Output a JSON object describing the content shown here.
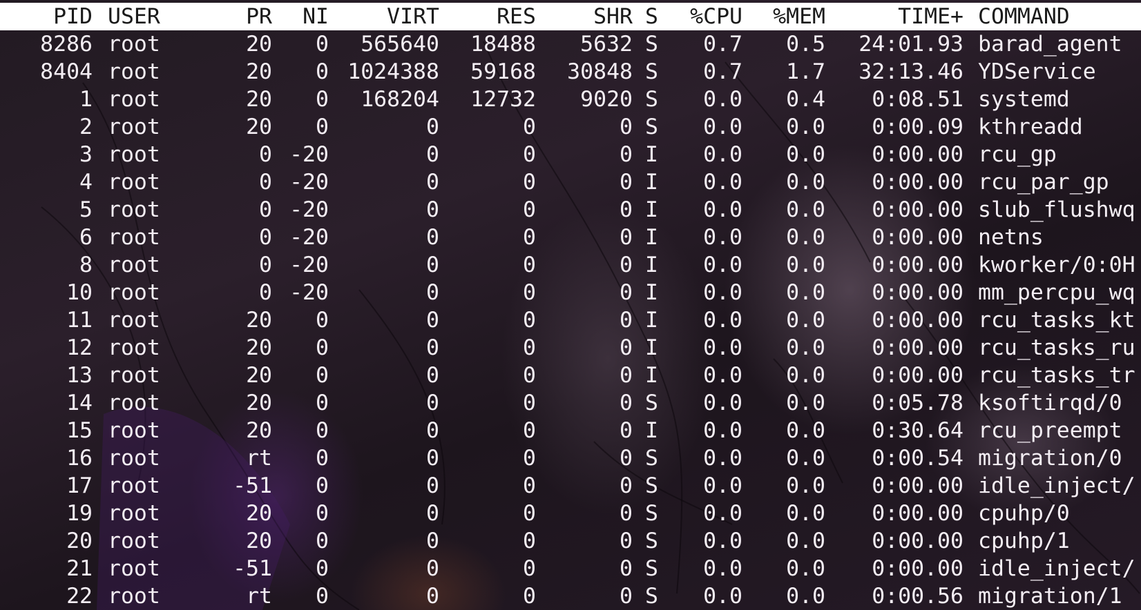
{
  "columns": [
    "PID",
    "USER",
    "PR",
    "NI",
    "VIRT",
    "RES",
    "SHR",
    "S",
    "%CPU",
    "%MEM",
    "TIME+",
    "COMMAND"
  ],
  "processes": [
    [
      "8286",
      "root",
      "20",
      "0",
      "565640",
      "18488",
      "5632",
      "S",
      "0.7",
      "0.5",
      "24:01.93",
      "barad_agent"
    ],
    [
      "8404",
      "root",
      "20",
      "0",
      "1024388",
      "59168",
      "30848",
      "S",
      "0.7",
      "1.7",
      "32:13.46",
      "YDService"
    ],
    [
      "1",
      "root",
      "20",
      "0",
      "168204",
      "12732",
      "9020",
      "S",
      "0.0",
      "0.4",
      "0:08.51",
      "systemd"
    ],
    [
      "2",
      "root",
      "20",
      "0",
      "0",
      "0",
      "0",
      "S",
      "0.0",
      "0.0",
      "0:00.09",
      "kthreadd"
    ],
    [
      "3",
      "root",
      "0",
      "-20",
      "0",
      "0",
      "0",
      "I",
      "0.0",
      "0.0",
      "0:00.00",
      "rcu_gp"
    ],
    [
      "4",
      "root",
      "0",
      "-20",
      "0",
      "0",
      "0",
      "I",
      "0.0",
      "0.0",
      "0:00.00",
      "rcu_par_gp"
    ],
    [
      "5",
      "root",
      "0",
      "-20",
      "0",
      "0",
      "0",
      "I",
      "0.0",
      "0.0",
      "0:00.00",
      "slub_flushwq"
    ],
    [
      "6",
      "root",
      "0",
      "-20",
      "0",
      "0",
      "0",
      "I",
      "0.0",
      "0.0",
      "0:00.00",
      "netns"
    ],
    [
      "8",
      "root",
      "0",
      "-20",
      "0",
      "0",
      "0",
      "I",
      "0.0",
      "0.0",
      "0:00.00",
      "kworker/0:0H"
    ],
    [
      "10",
      "root",
      "0",
      "-20",
      "0",
      "0",
      "0",
      "I",
      "0.0",
      "0.0",
      "0:00.00",
      "mm_percpu_wq"
    ],
    [
      "11",
      "root",
      "20",
      "0",
      "0",
      "0",
      "0",
      "I",
      "0.0",
      "0.0",
      "0:00.00",
      "rcu_tasks_kt"
    ],
    [
      "12",
      "root",
      "20",
      "0",
      "0",
      "0",
      "0",
      "I",
      "0.0",
      "0.0",
      "0:00.00",
      "rcu_tasks_ru"
    ],
    [
      "13",
      "root",
      "20",
      "0",
      "0",
      "0",
      "0",
      "I",
      "0.0",
      "0.0",
      "0:00.00",
      "rcu_tasks_tr"
    ],
    [
      "14",
      "root",
      "20",
      "0",
      "0",
      "0",
      "0",
      "S",
      "0.0",
      "0.0",
      "0:05.78",
      "ksoftirqd/0"
    ],
    [
      "15",
      "root",
      "20",
      "0",
      "0",
      "0",
      "0",
      "I",
      "0.0",
      "0.0",
      "0:30.64",
      "rcu_preempt"
    ],
    [
      "16",
      "root",
      "rt",
      "0",
      "0",
      "0",
      "0",
      "S",
      "0.0",
      "0.0",
      "0:00.54",
      "migration/0"
    ],
    [
      "17",
      "root",
      "-51",
      "0",
      "0",
      "0",
      "0",
      "S",
      "0.0",
      "0.0",
      "0:00.00",
      "idle_inject/"
    ],
    [
      "19",
      "root",
      "20",
      "0",
      "0",
      "0",
      "0",
      "S",
      "0.0",
      "0.0",
      "0:00.00",
      "cpuhp/0"
    ],
    [
      "20",
      "root",
      "20",
      "0",
      "0",
      "0",
      "0",
      "S",
      "0.0",
      "0.0",
      "0:00.00",
      "cpuhp/1"
    ],
    [
      "21",
      "root",
      "-51",
      "0",
      "0",
      "0",
      "0",
      "S",
      "0.0",
      "0.0",
      "0:00.00",
      "idle_inject/"
    ],
    [
      "22",
      "root",
      "rt",
      "0",
      "0",
      "0",
      "0",
      "S",
      "0.0",
      "0.0",
      "0:00.56",
      "migration/1"
    ]
  ],
  "colors": {
    "header_bg": "#ffffff",
    "header_text": "#1a1a1a",
    "row_text": "#f4eef4",
    "background": "#241b24"
  }
}
